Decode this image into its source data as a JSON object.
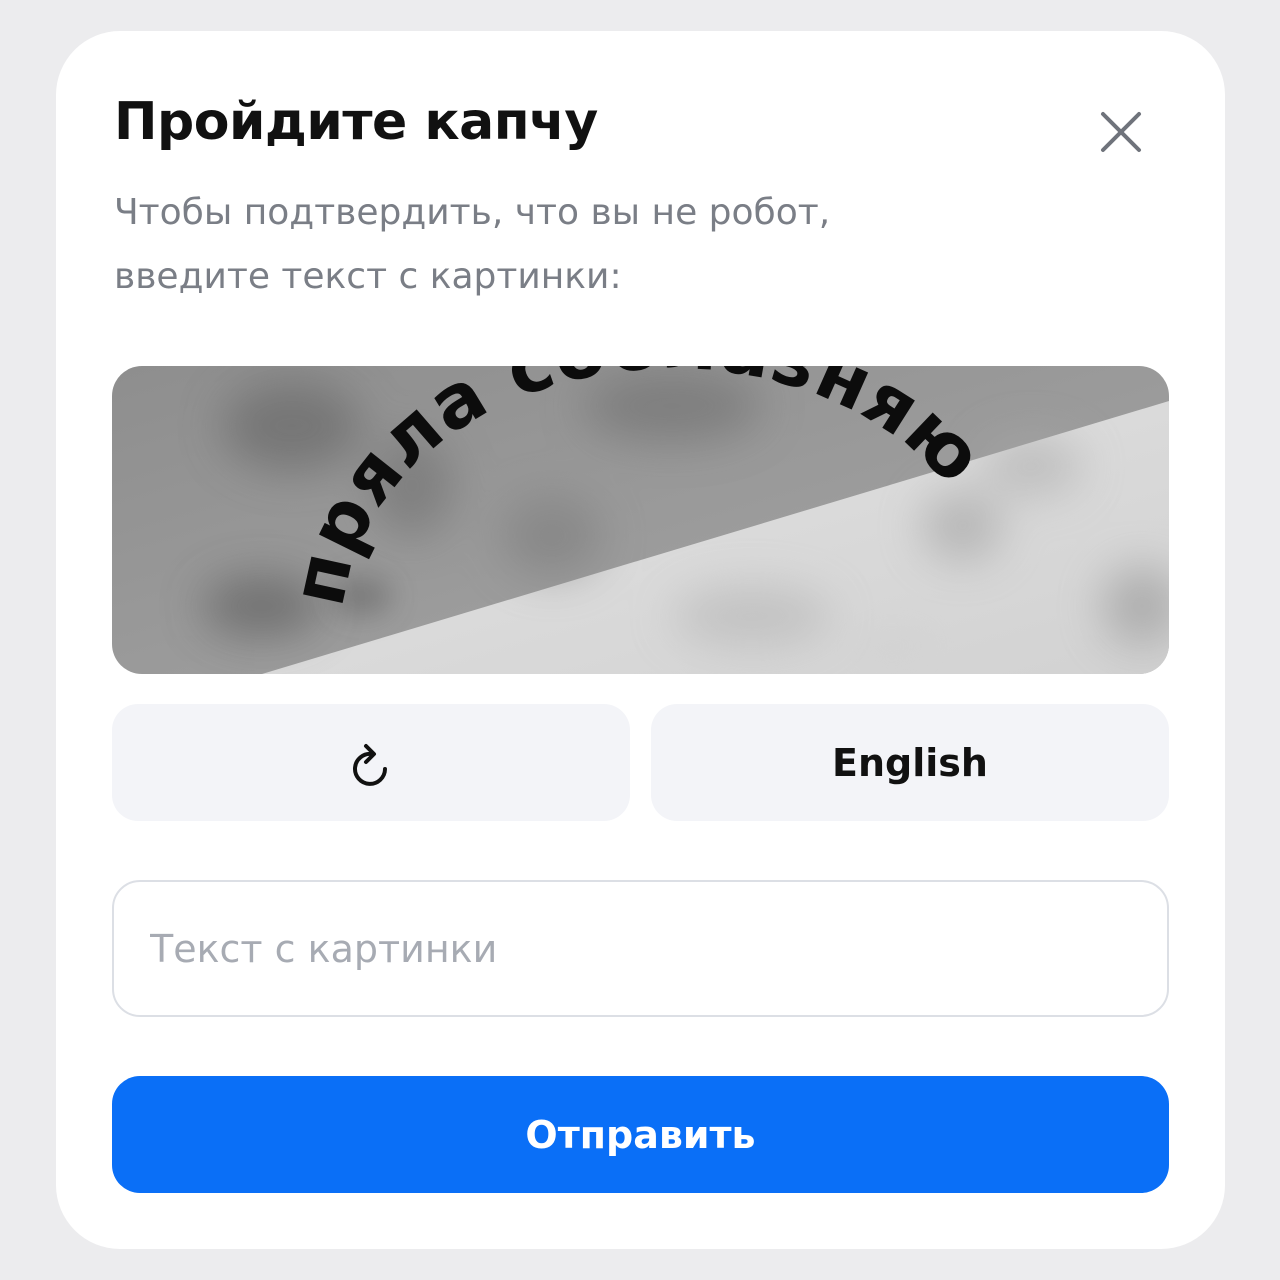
{
  "dialog": {
    "title": "Пройдите капчу",
    "subtitle_line1": "Чтобы подтвердить, что вы не робот,",
    "subtitle_line2": "введите текст с картинки:"
  },
  "captcha": {
    "text": "пряла соблазняю"
  },
  "buttons": {
    "refresh_icon": "refresh-icon",
    "language_label": "English",
    "submit_label": "Отправить",
    "close_icon": "close-icon"
  },
  "input": {
    "placeholder": "Текст с картинки",
    "value": ""
  },
  "colors": {
    "primary": "#0a6ff7",
    "secondary_bg": "#f3f4f8",
    "subtitle": "#7a7e86"
  }
}
